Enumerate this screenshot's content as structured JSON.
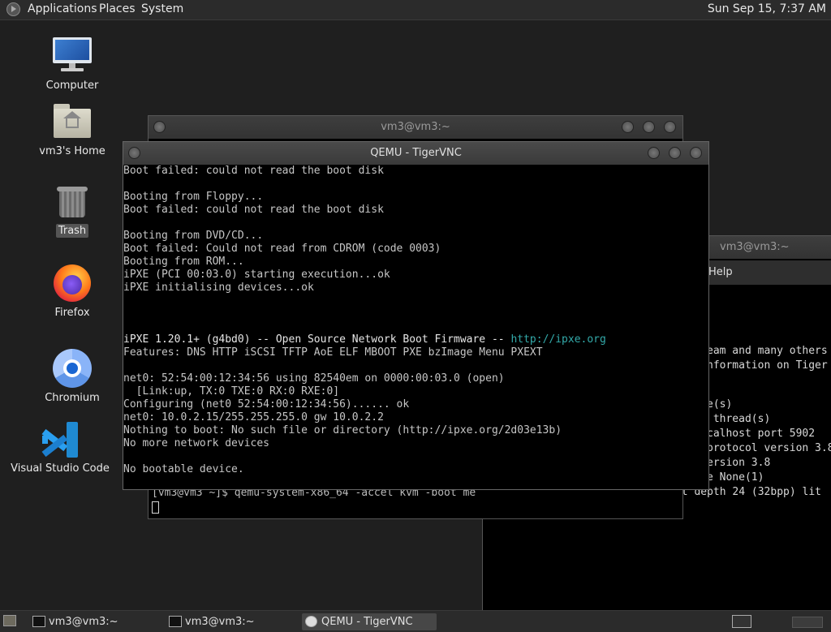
{
  "topbar": {
    "menus": [
      "Applications",
      "Places",
      "System"
    ],
    "clock": "Sun Sep 15,  7:37 AM"
  },
  "desktop": {
    "icons": [
      {
        "label": "Computer",
        "icon": "computer-icon"
      },
      {
        "label": "vm3's Home",
        "icon": "home-folder-icon"
      },
      {
        "label": "Trash",
        "icon": "trash-icon",
        "selected": true
      },
      {
        "label": "Firefox",
        "icon": "firefox-icon"
      },
      {
        "label": "Chromium",
        "icon": "chromium-icon"
      },
      {
        "label": "Visual Studio Code",
        "icon": "vscode-icon"
      }
    ]
  },
  "windows": {
    "back_terminal": {
      "title": "vm3@vm3:~",
      "prompt_line": "[vm3@vm3 ~]$ qemu-system-x86_64 -accel kvm -boot me"
    },
    "right_terminal": {
      "title": "vm3@vm3:~",
      "menu_item": "Help",
      "lines": [
        "eam and many others",
        "nformation on Tiger",
        "",
        "",
        "e(s)",
        " thread(s)",
        "calhost port 5902",
        "protocol version 3.8",
        "ersion 3.8",
        "e None(1)",
        "CConn:       Using pixel format depth 24 (32bpp) lit"
      ]
    },
    "qemu": {
      "title": "QEMU - TigerVNC",
      "console_lines": [
        "Boot failed: could not read the boot disk",
        "",
        "Booting from Floppy...",
        "Boot failed: could not read the boot disk",
        "",
        "Booting from DVD/CD...",
        "Boot failed: Could not read from CDROM (code 0003)",
        "Booting from ROM...",
        "iPXE (PCI 00:03.0) starting execution...ok",
        "iPXE initialising devices...ok",
        "",
        "",
        "",
        "iPXE 1.20.1+ (g4bd0) -- Open Source Network Boot Firmware -- ",
        "Features: DNS HTTP iSCSI TFTP AoE ELF MBOOT PXE bzImage Menu PXEXT",
        "",
        "net0: 52:54:00:12:34:56 using 82540em on 0000:00:03.0 (open)",
        "  [Link:up, TX:0 TXE:0 RX:0 RXE:0]",
        "Configuring (net0 52:54:00:12:34:56)...... ok",
        "net0: 10.0.2.15/255.255.255.0 gw 10.0.2.2",
        "Nothing to boot: No such file or directory (http://ipxe.org/2d03e13b)",
        "No more network devices",
        "",
        "No bootable device."
      ],
      "ipxe_link": "http://ipxe.org"
    }
  },
  "taskbar": {
    "tasks": [
      {
        "label": "vm3@vm3:~",
        "active": false
      },
      {
        "label": "vm3@vm3:~",
        "active": false
      },
      {
        "label": "QEMU - TigerVNC",
        "active": true
      }
    ]
  }
}
